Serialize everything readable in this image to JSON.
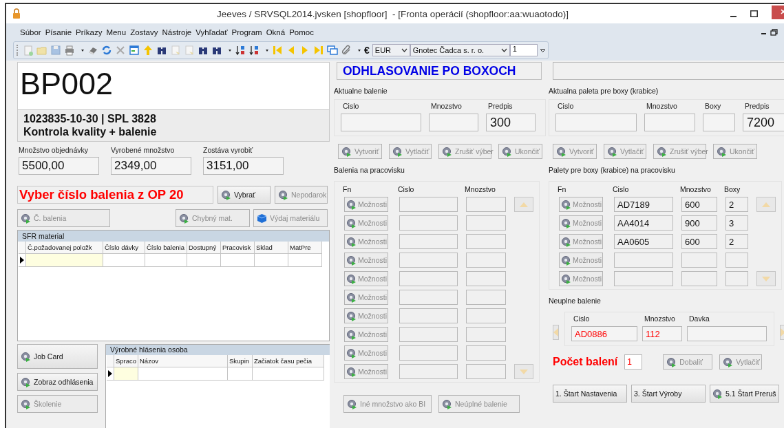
{
  "window": {
    "title": "Jeeves / SRVSQL2014.jvsken [shopfloor]  - [Fronta operácií (shopfloor:aa:wuaotodo)]"
  },
  "menu": [
    {
      "label": "Súbor"
    },
    {
      "label": "Písanie"
    },
    {
      "label": "Príkazy"
    },
    {
      "label": "Menu"
    },
    {
      "label": "Zostavy"
    },
    {
      "label": "Nástroje"
    },
    {
      "label": "Vyhľadať"
    },
    {
      "label": "Program"
    },
    {
      "label": "Okná"
    },
    {
      "label": "Pomoc"
    }
  ],
  "toolbar": {
    "currency_symbol": "€",
    "currency": "EUR",
    "company": "Gnotec Čadca s. r. o.",
    "number": "1"
  },
  "left": {
    "code": "BP002",
    "order": "1023835-10-30 | SPL 3828",
    "operation": "Kontrola kvality + balenie",
    "quantities": [
      {
        "label": "Množstvo objednávky",
        "value": "5500,00"
      },
      {
        "label": "Vyrobené množstvo",
        "value": "2349,00"
      },
      {
        "label": "Zostáva vyrobiť",
        "value": "3151,00"
      }
    ],
    "prompt": "Vyber číslo balenia z OP 20",
    "prompt_buttons": [
      {
        "label": "Vybrať",
        "disabled": false
      },
      {
        "label": "Nepodarok",
        "disabled": true
      }
    ],
    "tool_buttons": [
      {
        "label": "Č. balenia",
        "kind": "gear",
        "disabled": true
      },
      {
        "label": "Chybný mat.",
        "kind": "gear",
        "disabled": true
      },
      {
        "label": "Výdaj materiálu",
        "kind": "cube",
        "disabled": true
      }
    ],
    "sfr": {
      "title": "SFR material",
      "columns": [
        "Č.požadovanej položk",
        "Číslo dávky",
        "Číslo balenia",
        "Dostupný",
        "Pracovisk",
        "Sklad",
        "MatPre"
      ]
    },
    "side_buttons": [
      {
        "label": "Job Card",
        "disabled": false
      },
      {
        "label": "Zobraz odhlásenia",
        "disabled": false
      },
      {
        "label": "Školenie",
        "disabled": true
      }
    ],
    "reports": {
      "title": "Výrobné hlásenia osoba",
      "columns": [
        "Spraco",
        "Názov",
        "Skupin",
        "Začiatok času pečia"
      ]
    }
  },
  "middle": {
    "title": "ODHLASOVANIE PO BOXOCH",
    "current": {
      "title": "Aktualne balenie",
      "fields": [
        {
          "label": "Cislo"
        },
        {
          "label": "Mnozstvo"
        },
        {
          "label": "Predpis",
          "value": "300"
        }
      ]
    },
    "actions": [
      {
        "label": "Vytvoriť",
        "disabled": true
      },
      {
        "label": "Vytlačiť",
        "disabled": true
      },
      {
        "label": "Zrušiť výber",
        "disabled": true
      },
      {
        "label": "Ukončiť",
        "disabled": true
      }
    ],
    "packages": {
      "title": "Balenia na pracovisku",
      "columns": [
        "Fn",
        "Cislo",
        "Mnozstvo"
      ],
      "rows": [
        {
          "button": "Možnosti",
          "disabled": true
        },
        {
          "button": "Možnosti",
          "disabled": true
        },
        {
          "button": "Možnosti",
          "disabled": true
        },
        {
          "button": "Možnosti",
          "disabled": true
        },
        {
          "button": "Možnosti",
          "disabled": true
        },
        {
          "button": "Možnosti",
          "disabled": true
        },
        {
          "button": "Možnosti",
          "disabled": true
        },
        {
          "button": "Možnosti",
          "disabled": true
        },
        {
          "button": "Možnosti",
          "disabled": true
        },
        {
          "button": "Možnosti",
          "disabled": true
        }
      ]
    },
    "bottom_buttons": [
      {
        "label": "Iné množstvo ako BI",
        "disabled": true
      },
      {
        "label": "Neúplné balenie",
        "disabled": true
      }
    ]
  },
  "right": {
    "current": {
      "title": "Aktualna paleta pre boxy (krabice)",
      "fields": [
        {
          "label": "Cislo"
        },
        {
          "label": "Mnozstvo"
        },
        {
          "label": "Boxy"
        },
        {
          "label": "Predpis",
          "value": "7200"
        }
      ]
    },
    "actions": [
      {
        "label": "Vytvoriť",
        "disabled": true
      },
      {
        "label": "Vytlačiť",
        "disabled": true
      },
      {
        "label": "Zrušiť výber",
        "disabled": true
      },
      {
        "label": "Ukončiť",
        "disabled": true
      }
    ],
    "pallets": {
      "title": "Palety pre boxy (krabice) na pracovisku",
      "columns": [
        "Fn",
        "Cislo",
        "Mnozstvo",
        "Boxy"
      ],
      "rows": [
        {
          "button": "Možnosti",
          "disabled": true,
          "cislo": "AD7189",
          "mnozstvo": "600",
          "boxy": "2"
        },
        {
          "button": "Možnosti",
          "disabled": true,
          "cislo": "AA4014",
          "mnozstvo": "900",
          "boxy": "3"
        },
        {
          "button": "Možnosti",
          "disabled": true,
          "cislo": "AA0605",
          "mnozstvo": "600",
          "boxy": "2"
        },
        {
          "button": "Možnosti",
          "disabled": true
        },
        {
          "button": "Možnosti",
          "disabled": true
        }
      ]
    },
    "incomplete": {
      "title": "Neuplne balenie",
      "fields": [
        {
          "label": "Cislo",
          "value": "AD0886"
        },
        {
          "label": "Mnozstvo",
          "value": "112"
        },
        {
          "label": "Davka"
        }
      ]
    },
    "count": {
      "label": "Počet balení",
      "value": "1"
    },
    "count_buttons": [
      {
        "label": "Dobaliť",
        "disabled": true
      },
      {
        "label": "Vytlačiť",
        "disabled": true
      }
    ],
    "start_buttons": [
      {
        "label": "1. Štart Nastavenia",
        "kind": "plain",
        "disabled": false
      },
      {
        "label": "3. Štart Výroby",
        "kind": "plain",
        "disabled": false
      },
      {
        "label": "5.1 Štart Preruš",
        "kind": "gear",
        "disabled": false
      }
    ]
  }
}
